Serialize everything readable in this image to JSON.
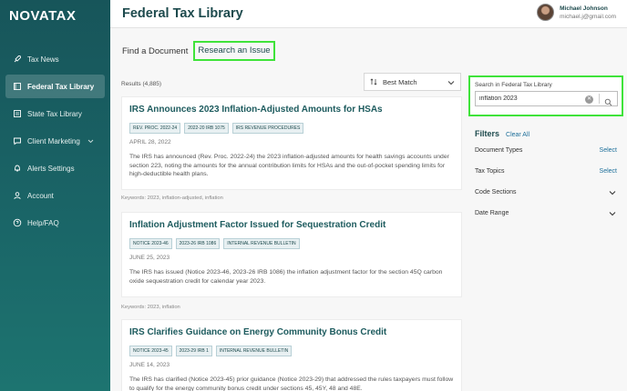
{
  "app": {
    "logo": "NOVATAX"
  },
  "sidebar": {
    "items": [
      {
        "label": "Tax News",
        "icon": "rocket-icon"
      },
      {
        "label": "Federal Tax Library",
        "icon": "book-icon",
        "active": true
      },
      {
        "label": "State Tax Library",
        "icon": "document-icon"
      },
      {
        "label": "Client Marketing",
        "icon": "chat-icon"
      },
      {
        "label": "Alerts Settings",
        "icon": "bell-icon"
      },
      {
        "label": "Account",
        "icon": "user-icon"
      },
      {
        "label": "Help/FAQ",
        "icon": "help-icon"
      }
    ]
  },
  "header": {
    "title": "Federal Tax Library",
    "user_name": "Michael Johnson",
    "user_email": "michael.j@gmail.com"
  },
  "tabs": [
    {
      "label": "Find a Document"
    },
    {
      "label": "Research an Issue"
    }
  ],
  "results": {
    "count_label": "Results (4,885)",
    "sort_label": "Best Match",
    "items": [
      {
        "title": "IRS Announces 2023 Inflation-Adjusted Amounts for HSAs",
        "tags": [
          "REV. PROC. 2022-24",
          "2022-20 IRB 1075",
          "IRS REVENUE PROCEDURES"
        ],
        "date": "APRIL 28, 2022",
        "body": "The IRS has announced (Rev. Proc. 2022-24) the 2023 inflation-adjusted amounts for health savings accounts under section 223, noting the amounts for the annual contribution limits for HSAs and the out-of-pocket spending limits for high-deductible health plans.",
        "keywords": "Keywords: 2023, inflation-adjusted, inflation"
      },
      {
        "title": "Inflation Adjustment Factor Issued for Sequestration Credit",
        "tags": [
          "NOTICE 2023-46",
          "2023-26 IRB 1086",
          "INTERNAL REVENUE BULLETIN"
        ],
        "date": "JUNE 25, 2023",
        "body": "The IRS has issued (Notice 2023-46, 2023-26 IRB 1086) the inflation adjustment factor for the section 45Q carbon oxide sequestration credit for calendar year 2023.",
        "keywords": "Keywords: 2023, inflation"
      },
      {
        "title": "IRS Clarifies Guidance on Energy Community Bonus Credit",
        "tags": [
          "NOTICE 2023-45",
          "2023-29 IRB 1",
          "INTERNAL REVENUE BULLETIN"
        ],
        "date": "JUNE 14, 2023",
        "body": "The IRS has clarified (Notice 2023-45) prior guidance (Notice 2023-29) that addressed the rules taxpayers must follow to qualify for the energy community bonus credit under sections 45, 45Y, 48 and 48E."
      }
    ]
  },
  "search": {
    "label": "Search in Federal Tax Library",
    "value": "inflation 2023"
  },
  "filters": {
    "title": "Filters",
    "clear_label": "Clear All",
    "rows": [
      {
        "label": "Document Types",
        "action": "Select"
      },
      {
        "label": "Tax Topics",
        "action": "Select"
      },
      {
        "label": "Code Sections"
      },
      {
        "label": "Date Range"
      }
    ]
  },
  "colors": {
    "accent": "#1d5b5e",
    "highlight": "#3fe33a",
    "link": "#1d6f9a"
  }
}
